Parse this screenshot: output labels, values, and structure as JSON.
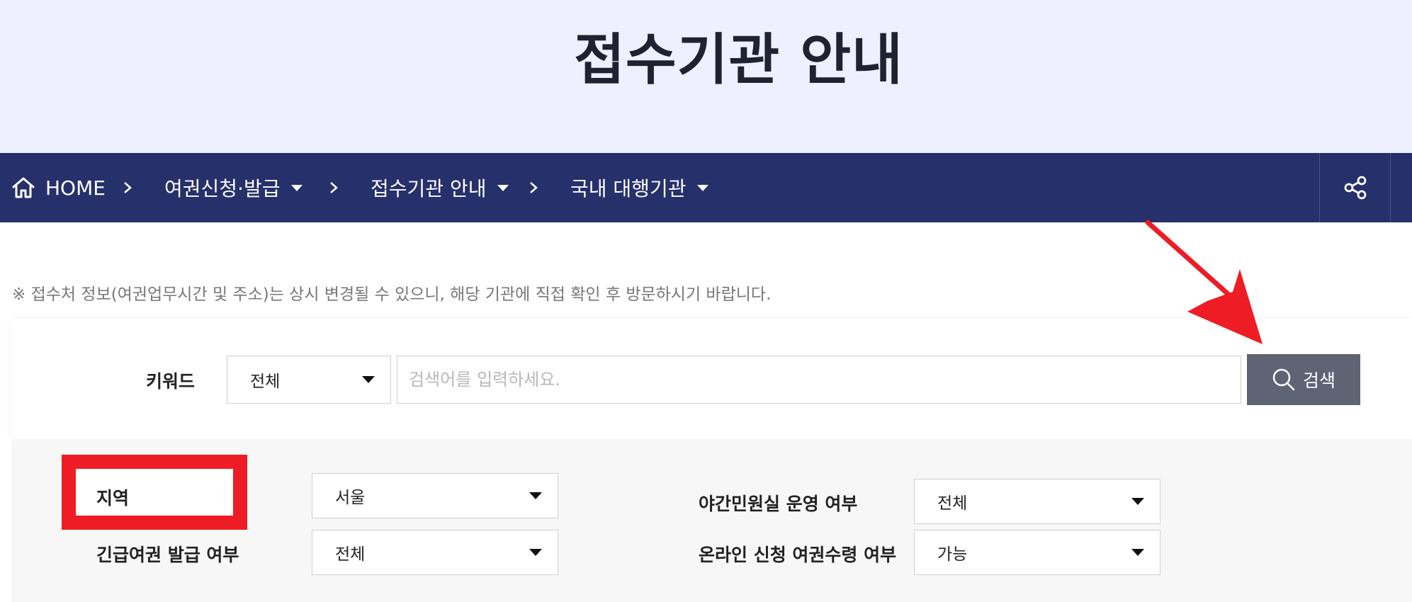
{
  "page_title": "접수기관 안내",
  "breadcrumb": {
    "home_label": "HOME",
    "items": [
      {
        "label": "여권신청·발급"
      },
      {
        "label": "접수기관 안내"
      },
      {
        "label": "국내 대행기관"
      }
    ]
  },
  "notice": "※ 접수처 정보(여권업무시간 및 주소)는 상시 변경될 수 있으니, 해당 기관에 직접 확인 후 방문하시기 바랍니다.",
  "search": {
    "keyword_label": "키워드",
    "scope_value": "전체",
    "placeholder": "검색어를 입력하세요.",
    "button_label": "검색"
  },
  "filters": {
    "region": {
      "label": "지역",
      "value": "서울"
    },
    "night_office": {
      "label": "야간민원실 운영 여부",
      "value": "전체"
    },
    "urgent_passport": {
      "label": "긴급여권 발급 여부",
      "value": "전체"
    },
    "online_pickup": {
      "label": "온라인 신청 여권수령 여부",
      "value": "가능"
    }
  },
  "colors": {
    "hero_bg": "#eef0ff",
    "nav_bg": "#26306b",
    "search_button": "#5f6474",
    "annotation_red": "#ee1c24"
  },
  "icons": {
    "home": "home-icon",
    "share": "share-icon",
    "search": "search-icon",
    "chevron": "chevron-right-icon",
    "dropdown": "caret-down-icon"
  }
}
